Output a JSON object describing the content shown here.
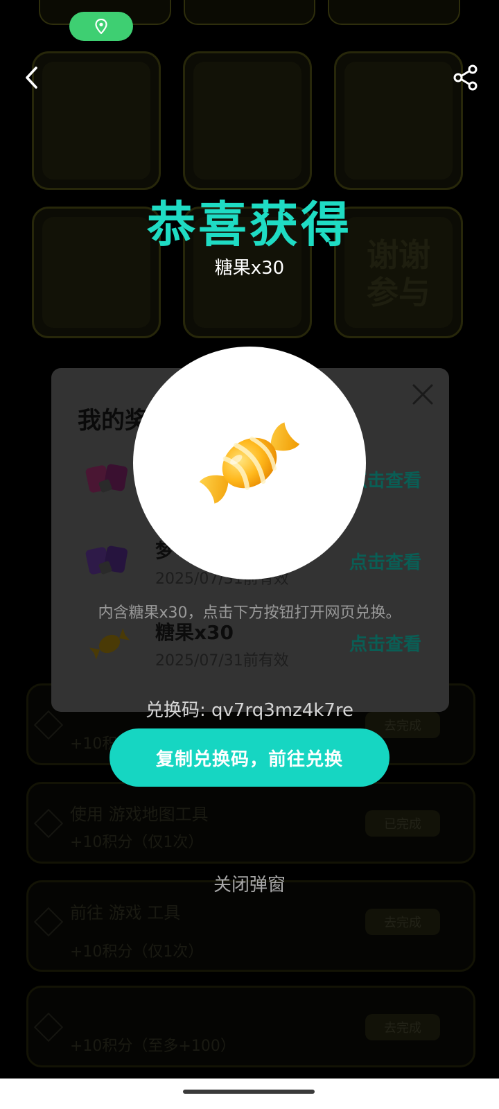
{
  "background": {
    "location_pill_icon": "location-pin-icon",
    "grid_cards": [
      {
        "caption": "",
        "big_text": ""
      },
      {
        "caption": "",
        "big_text": ""
      },
      {
        "caption": "",
        "big_text": ""
      },
      {
        "caption": "",
        "big_text": ""
      },
      {
        "caption": "",
        "big_text": ""
      },
      {
        "caption": "",
        "big_text": "谢谢参与"
      }
    ],
    "task_rows": [
      {
        "line1": "",
        "line2": "+10积分",
        "button": "去完成"
      },
      {
        "line1": "使用 游戏地图工具",
        "line2": "+10积分（仅1次）",
        "button": "已完成"
      },
      {
        "line1": "前往 游戏 工具",
        "line2": "+10积分（仅1次）",
        "button": "去完成"
      },
      {
        "line1": "",
        "line2": "+10积分（至多+100）",
        "button": "去完成"
      }
    ]
  },
  "topbar": {
    "back_icon": "chevron-left-icon",
    "share_icon": "share-icon"
  },
  "prize_dialog": {
    "title": "我的奖",
    "close_icon": "close-icon",
    "items": [
      {
        "name": "",
        "date": "",
        "view": "点击查看",
        "icon": "pink-ticket-icon"
      },
      {
        "name": "梦",
        "date": "2025/07/31前有效",
        "view": "点击查看",
        "icon": "purple-ticket-icon"
      },
      {
        "name": "糖果x30",
        "date": "2025/07/31前有效",
        "view": "点击查看",
        "icon": "candy-icon"
      }
    ]
  },
  "reward_popup": {
    "title": "恭喜获得",
    "subtitle": "糖果x30",
    "image_icon": "candy-icon",
    "description": "内含糖果x30，点击下方按钮打开网页兑换。",
    "code": "兑换码: qv7rq3mz4k7re",
    "copy_button": "复制兑换码，前往兑换",
    "close_label": "关闭弹窗"
  },
  "colors": {
    "accent": "#16d6c2",
    "title": "#1fdcc4",
    "location_green": "#3ecf72"
  }
}
